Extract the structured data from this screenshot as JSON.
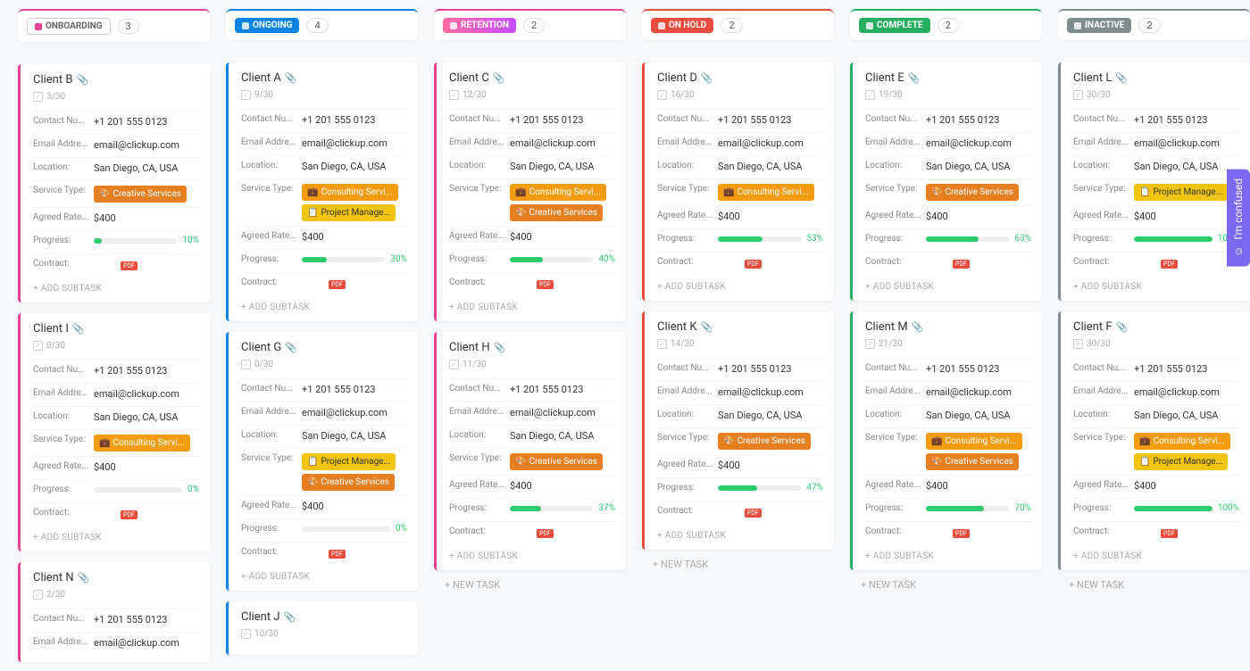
{
  "feedback_label": "I'm confused",
  "field_labels": {
    "contact": "Contact Nu...",
    "email": "Email Addre...",
    "location": "Location:",
    "service": "Service Type:",
    "rate": "Agreed Rate...",
    "progress": "Progress:",
    "contract": "Contract:"
  },
  "add_subtask_label": "+ ADD SUBTASK",
  "new_task_label": "+ NEW TASK",
  "pdf_label": "PDF",
  "columns": [
    {
      "id": "onboarding",
      "label": "ONBOARDING",
      "accent": "#e84393",
      "count": "3",
      "pill_style": "outline",
      "cards": [
        {
          "name": "Client B",
          "sub": "3/30",
          "contact": "+1 201 555 0123",
          "email": "email@clickup.com",
          "location": "San Diego, CA, USA",
          "services": [
            {
              "t": "Creative Services",
              "c": "creative"
            }
          ],
          "rate": "$400",
          "progress": 10
        },
        {
          "name": "Client I",
          "sub": "0/30",
          "contact": "+1 201 555 0123",
          "email": "email@clickup.com",
          "location": "San Diego, CA, USA",
          "services": [
            {
              "t": "Consulting Servi...",
              "c": "consulting"
            }
          ],
          "rate": "$400",
          "progress": 0
        },
        {
          "name": "Client N",
          "sub": "2/30",
          "contact": "+1 201 555 0123",
          "email": "email@clickup.com",
          "partial": true
        }
      ]
    },
    {
      "id": "ongoing",
      "label": "ONGOING",
      "accent": "#0984e3",
      "count": "4",
      "cards": [
        {
          "name": "Client A",
          "sub": "9/30",
          "contact": "+1 201 555 0123",
          "email": "email@clickup.com",
          "location": "San Diego, CA, USA",
          "services": [
            {
              "t": "Consulting Servi...",
              "c": "consulting"
            },
            {
              "t": "Project Manage...",
              "c": "project"
            }
          ],
          "rate": "$400",
          "progress": 30
        },
        {
          "name": "Client G",
          "sub": "0/30",
          "contact": "+1 201 555 0123",
          "email": "email@clickup.com",
          "location": "San Diego, CA, USA",
          "services": [
            {
              "t": "Project Manage...",
              "c": "project"
            },
            {
              "t": "Creative Services",
              "c": "creative"
            }
          ],
          "rate": "$400",
          "progress": 0
        },
        {
          "name": "Client J",
          "sub": "10/30",
          "partial": true
        }
      ]
    },
    {
      "id": "retention",
      "label": "RETENTION",
      "accent": "#e84393",
      "gradient": true,
      "count": "2",
      "cards": [
        {
          "name": "Client C",
          "sub": "12/30",
          "contact": "+1 201 555 0123",
          "email": "email@clickup.com",
          "location": "San Diego, CA, USA",
          "services": [
            {
              "t": "Consulting Servi...",
              "c": "consulting"
            },
            {
              "t": "Creative Services",
              "c": "creative"
            }
          ],
          "rate": "$400",
          "progress": 40
        },
        {
          "name": "Client H",
          "sub": "11/30",
          "contact": "+1 201 555 0123",
          "email": "email@clickup.com",
          "location": "San Diego, CA, USA",
          "services": [
            {
              "t": "Creative Services",
              "c": "creative"
            }
          ],
          "rate": "$400",
          "progress": 37
        }
      ],
      "show_new_task": true
    },
    {
      "id": "onhold",
      "label": "ON HOLD",
      "accent": "#e74c3c",
      "count": "2",
      "cards": [
        {
          "name": "Client D",
          "sub": "16/30",
          "contact": "+1 201 555 0123",
          "email": "email@clickup.com",
          "location": "San Diego, CA, USA",
          "services": [
            {
              "t": "Consulting Servi...",
              "c": "consulting"
            }
          ],
          "rate": "$400",
          "progress": 53
        },
        {
          "name": "Client K",
          "sub": "14/30",
          "contact": "+1 201 555 0123",
          "email": "email@clickup.com",
          "location": "San Diego, CA, USA",
          "services": [
            {
              "t": "Creative Services",
              "c": "creative"
            }
          ],
          "rate": "$400",
          "progress": 47
        }
      ],
      "show_new_task": true
    },
    {
      "id": "complete",
      "label": "COMPLETE",
      "accent": "#27ae60",
      "count": "2",
      "cards": [
        {
          "name": "Client E",
          "sub": "19/30",
          "contact": "+1 201 555 0123",
          "email": "email@clickup.com",
          "location": "San Diego, CA, USA",
          "services": [
            {
              "t": "Creative Services",
              "c": "creative"
            }
          ],
          "rate": "$400",
          "progress": 63
        },
        {
          "name": "Client M",
          "sub": "21/30",
          "contact": "+1 201 555 0123",
          "email": "email@clickup.com",
          "location": "San Diego, CA, USA",
          "services": [
            {
              "t": "Consulting Servi...",
              "c": "consulting"
            },
            {
              "t": "Creative Services",
              "c": "creative"
            }
          ],
          "rate": "$400",
          "progress": 70
        }
      ],
      "show_new_task": true
    },
    {
      "id": "inactive",
      "label": "INACTIVE",
      "accent": "#7f8c8d",
      "count": "2",
      "cards": [
        {
          "name": "Client L",
          "sub": "30/30",
          "contact": "+1 201 555 0123",
          "email": "email@clickup.com",
          "location": "San Diego, CA, USA",
          "services": [
            {
              "t": "Project Manage...",
              "c": "project"
            }
          ],
          "rate": "$400",
          "progress": 100
        },
        {
          "name": "Client F",
          "sub": "30/30",
          "contact": "+1 201 555 0123",
          "email": "email@clickup.com",
          "location": "San Diego, CA, USA",
          "services": [
            {
              "t": "Consulting Servi...",
              "c": "consulting"
            },
            {
              "t": "Project Manage...",
              "c": "project"
            }
          ],
          "rate": "$400",
          "progress": 100
        }
      ],
      "show_new_task": true
    }
  ]
}
